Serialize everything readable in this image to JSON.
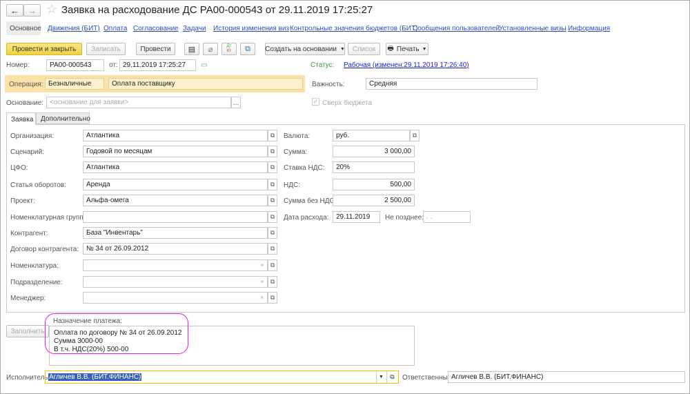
{
  "title": "Заявка на расходование ДС РА00-000543 от 29.11.2019 17:25:27",
  "nav": {
    "back": "←",
    "forward": "→",
    "star": "☆"
  },
  "tabs": [
    "Основное",
    "Движения (БИТ)",
    "Оплата",
    "Согласование",
    "Задачи",
    "История изменения виз",
    "Контрольные значения бюджетов (БИТ)",
    "Сообщения пользователей",
    "Установленные визы",
    "Информация"
  ],
  "toolbar": {
    "post_close": "Провести и закрыть",
    "save": "Записать",
    "post": "Провести",
    "create_based": "Создать на основании",
    "list": "Список",
    "print": "Печать",
    "dtkt_top": "Дт",
    "dtkt_bottom": "Кт"
  },
  "header": {
    "number_label": "Номер:",
    "number": "РА00-000543",
    "date_label": "от:",
    "date": "29.11.2019 17:25:27",
    "status_label": "Статус:",
    "status": "Рабочая (изменен:29.11.2019 17:26:40)",
    "operation_label": "Операция:",
    "operation_type": "Безналичные",
    "operation": "Оплата поставщику",
    "importance_label": "Важность:",
    "importance": "Средняя",
    "basis_label": "Основание:",
    "basis_placeholder": "<основание для заявки>",
    "over_budget": "Сверх бюджета"
  },
  "inner_tabs": [
    "Заявка",
    "Дополнительно"
  ],
  "left_fields": [
    {
      "label": "Организация:",
      "value": "Атлантика"
    },
    {
      "label": "Сценарий:",
      "value": "Годовой по месяцам"
    },
    {
      "label": "ЦФО:",
      "value": "Атлантика"
    },
    {
      "label": "Статья оборотов:",
      "value": "Аренда"
    },
    {
      "label": "Проект:",
      "value": "Альфа-омега"
    },
    {
      "label": "Номенклатурная группа:",
      "value": ""
    },
    {
      "label": "Контрагент:",
      "value": "База \"Инвентарь\""
    },
    {
      "label": "Договор контрагента:",
      "value": "№ 34 от 26.09.2012"
    },
    {
      "label": "Номенклатура:",
      "value": ""
    },
    {
      "label": "Подразделение:",
      "value": ""
    },
    {
      "label": "Менеджер:",
      "value": ""
    }
  ],
  "right_fields": {
    "currency_label": "Валюта:",
    "currency": "руб.",
    "sum_label": "Сумма:",
    "sum": "3 000,00",
    "vat_rate_label": "Ставка НДС:",
    "vat_rate": "20%",
    "vat_label": "НДС:",
    "vat": "500,00",
    "sum_no_vat_label": "Сумма без НДС:",
    "sum_no_vat": "2 500,00",
    "expense_date_label": "Дата расхода:",
    "expense_date": "29.11.2019",
    "not_later_label": "Не позднее:",
    "not_later": " .  . "
  },
  "payment": {
    "fill": "Заполнить",
    "label": "Назначение платежа:",
    "lines": [
      "Оплата по договору № 34 от 26.09.2012",
      "Сумма 3000-00",
      "В т.ч. НДС(20%) 500-00"
    ]
  },
  "footer": {
    "executor_label": "Исполнитель:",
    "executor": "Агличев В.В. (БИТ.ФИНАНС)",
    "responsible_label": "Ответственный:",
    "responsible": "Агличев В.В. (БИТ.ФИНАНС)"
  },
  "colors": {
    "accent_yellow": "#f5d94a",
    "link": "#2b4fb5",
    "status_green": "#3a9a3a",
    "highlight": "#e01ee0"
  }
}
